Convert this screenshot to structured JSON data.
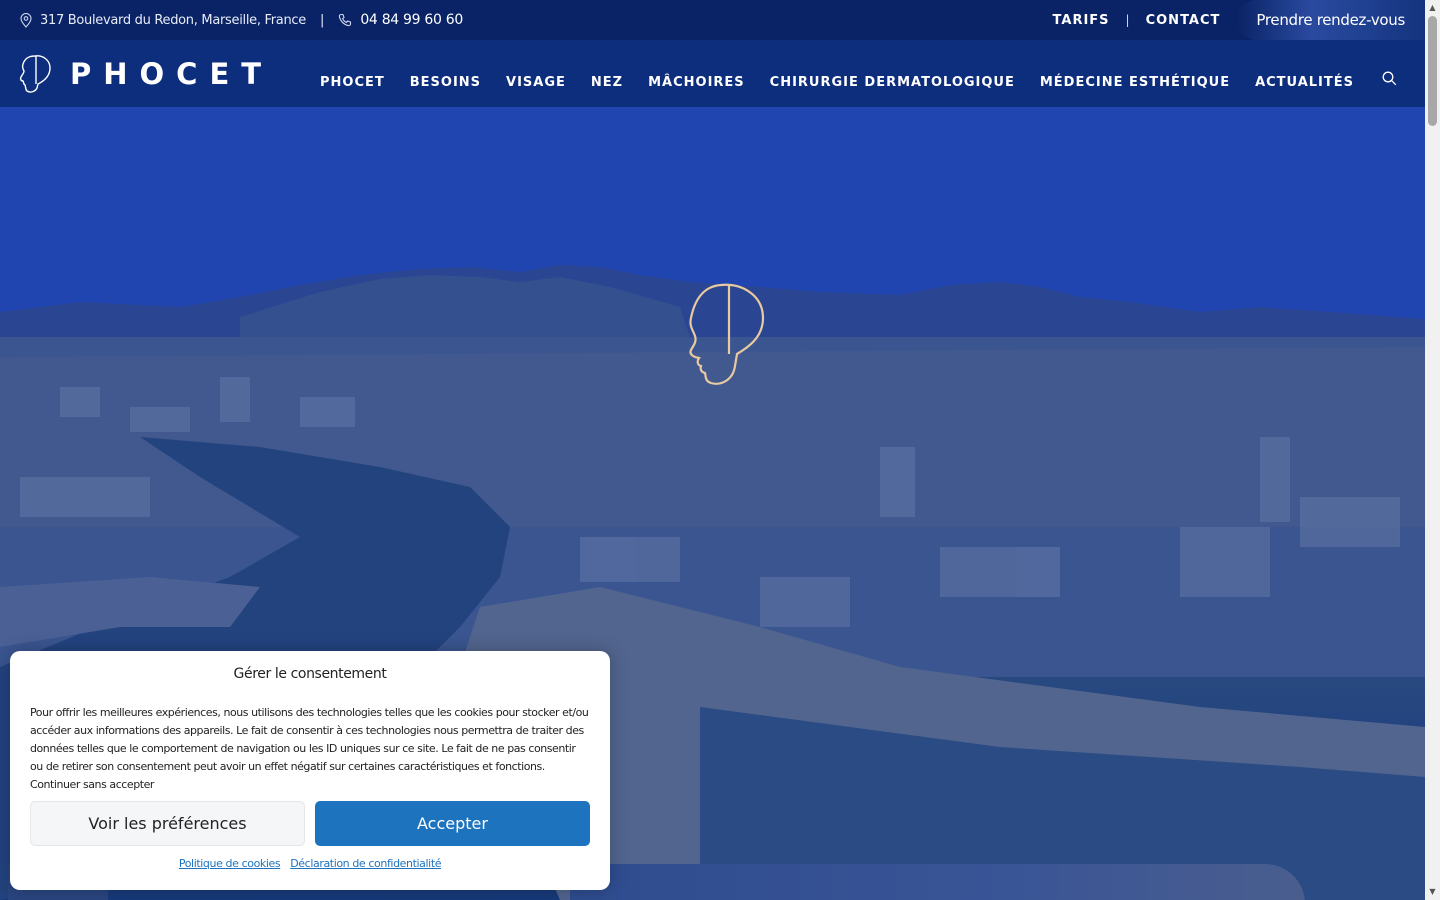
{
  "topbar": {
    "address": "317 Boulevard du Redon, Marseille, France",
    "divider": "|",
    "phone": "04 84 99 60 60",
    "links": [
      {
        "label": "TARIFS"
      },
      {
        "label": "CONTACT"
      }
    ],
    "link_separator": "|",
    "appointment_button": "Prendre rendez-vous"
  },
  "brand": {
    "name": "PHOCET"
  },
  "nav": {
    "items": [
      {
        "label": "PHOCET"
      },
      {
        "label": "BESOINS"
      },
      {
        "label": "VISAGE"
      },
      {
        "label": "NEZ"
      },
      {
        "label": "MÂCHOIRES"
      },
      {
        "label": "CHIRURGIE DERMATOLOGIQUE"
      },
      {
        "label": "MÉDECINE ESTHÉTIQUE"
      },
      {
        "label": "ACTUALITÉS"
      }
    ],
    "search_icon": "search-icon"
  },
  "consent": {
    "title": "Gérer le consentement",
    "text": "Pour offrir les meilleures expériences, nous utilisons des technologies telles que les cookies pour stocker et/ou accéder aux informations des appareils. Le fait de consentir à ces technologies nous permettra de traiter des données telles que le comportement de navigation ou les ID uniques sur ce site. Le fait de ne pas consentir ou de retirer son consentement peut avoir un effet négatif sur certaines caractéristiques et fonctions. Continuer sans accepter",
    "preferences_button": "Voir les préférences",
    "accept_button": "Accepter",
    "cookie_policy_link": "Politique de cookies",
    "privacy_link": "Déclaration de confidentialité"
  },
  "colors": {
    "topbar_bg": "#0a2366",
    "nav_bg": "#0d2d7d",
    "emblem_gold": "#e9c9a0",
    "accept_blue": "#1e73be"
  }
}
